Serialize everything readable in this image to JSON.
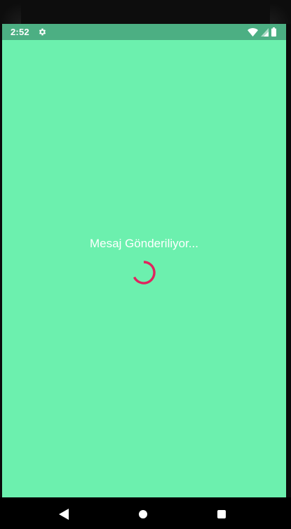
{
  "status_bar": {
    "time": "2:52",
    "icons": [
      "settings-icon",
      "wifi-icon",
      "signal-icon",
      "battery-icon"
    ],
    "background_color": "#4caf83"
  },
  "main": {
    "message": "Mesaj Gönderiliyor...",
    "background_color": "#6cf0ae",
    "spinner_color": "#e0245e"
  },
  "nav_bar": {
    "icons": [
      "back-icon",
      "home-icon",
      "recents-icon"
    ]
  }
}
